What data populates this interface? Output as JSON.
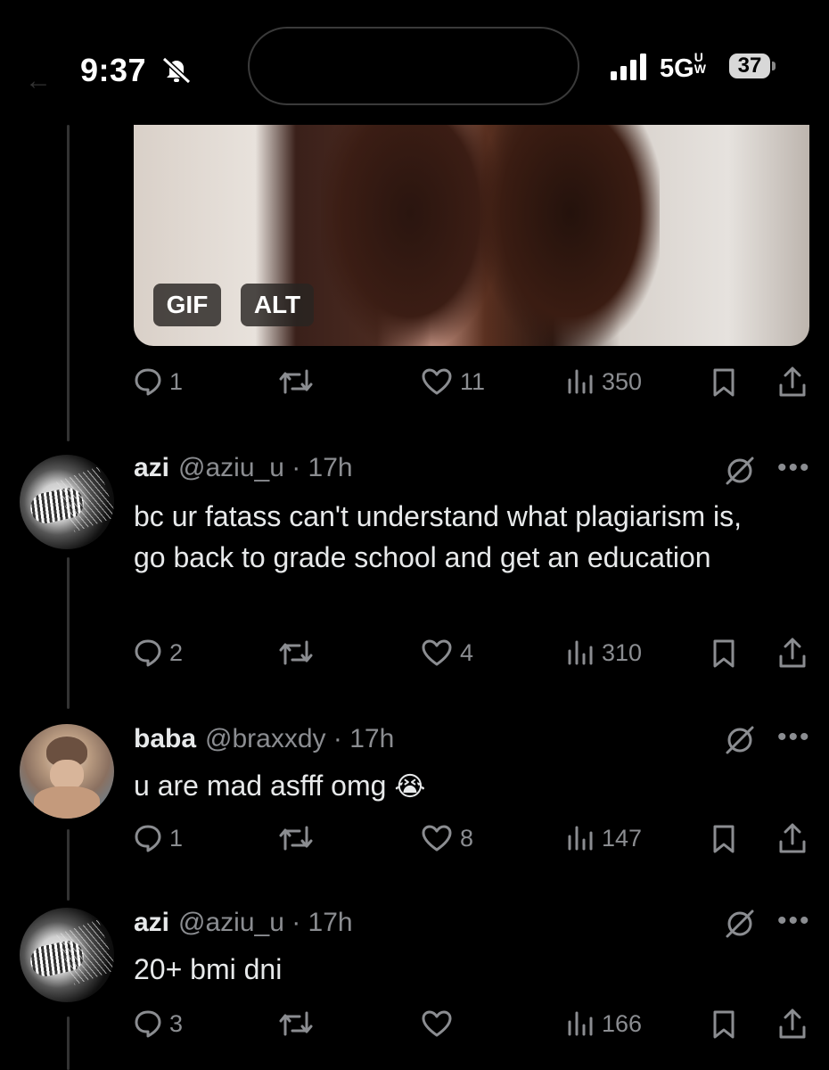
{
  "status_bar": {
    "time": "9:37",
    "network": "5G",
    "network_sup": "UW",
    "battery": "37"
  },
  "media": {
    "gif_label": "GIF",
    "alt_label": "ALT"
  },
  "tweets": [
    {
      "actions": {
        "replies": "1",
        "retweets": "",
        "likes": "11",
        "views": "350"
      }
    },
    {
      "name": "azi",
      "handle": "@aziu_u",
      "time": "· 17h",
      "text": "bc ur fatass can't understand what plagiarism is, go back to grade school and get an education",
      "actions": {
        "replies": "2",
        "retweets": "",
        "likes": "4",
        "views": "310"
      }
    },
    {
      "name": "baba",
      "handle": "@braxxdy",
      "time": "· 17h",
      "text": "u are mad asfff omg",
      "emoji": "😭",
      "actions": {
        "replies": "1",
        "retweets": "",
        "likes": "8",
        "views": "147"
      }
    },
    {
      "name": "azi",
      "handle": "@aziu_u",
      "time": "· 17h",
      "text": "20+ bmi dni",
      "actions": {
        "replies": "3",
        "retweets": "",
        "likes": "",
        "views": "166"
      }
    }
  ],
  "icons": {
    "reply": "reply-icon",
    "retweet": "retweet-icon",
    "like": "heart-icon",
    "views": "views-icon",
    "bookmark": "bookmark-icon",
    "share": "share-icon",
    "grok": "slash-circle-icon",
    "more": "more-icon"
  },
  "colors": {
    "background": "#000000",
    "text_primary": "#e7e9ea",
    "text_secondary": "#8b8d91"
  }
}
